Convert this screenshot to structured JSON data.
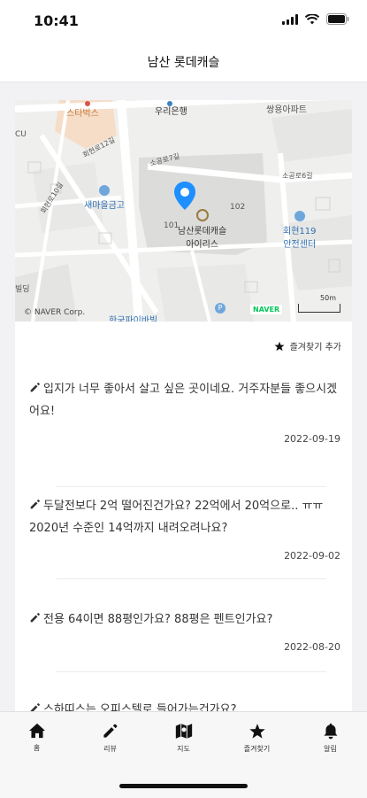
{
  "status_bar": {
    "time": "10:41"
  },
  "nav": {
    "title": "남산 롯데캐슬"
  },
  "map": {
    "labels": {
      "starbucks": "스타벅스",
      "woori": "우리은행",
      "ssangyong": "쌍용아파트",
      "street1": "회현로12길",
      "street2": "소공로7길",
      "street3": "소공로6길",
      "street4": "회현로10길",
      "saemaeul": "새마을금고",
      "bld101": "101",
      "bld102": "102",
      "complex": "남산롯데캐슬",
      "complex2": "아이리스",
      "safety": "회현119",
      "safety2": "안전센터",
      "building": "빌딩",
      "left_edge": "CU",
      "parking": "한국파이바빌",
      "copyright": "© NAVER Corp.",
      "naver": "NAVER",
      "scale": "50m"
    }
  },
  "favorite": {
    "label": "즐겨찾기 추가"
  },
  "reviews": [
    {
      "text": "입지가 너무 좋아서 살고 싶은 곳이네요. 거주자분들 좋으시겠어요!",
      "date": "2022-09-19"
    },
    {
      "text": "두달전보다 2억 떨어진건가요? 22억에서 20억으로.. ㅠㅠ 2020년 수준인 14억까지 내려오려나요?",
      "date": "2022-09-02"
    },
    {
      "text": "전용 64이면 88평인가요? 88평은 펜트인가요?",
      "date": "2022-08-20"
    },
    {
      "text": "스하띠스는 오피스텔로 들어가는건가요?",
      "date": ""
    }
  ],
  "tabs": [
    {
      "label": "홈",
      "icon": "home-icon"
    },
    {
      "label": "리뷰",
      "icon": "pencil-icon"
    },
    {
      "label": "지도",
      "icon": "map-icon"
    },
    {
      "label": "즐겨찾기",
      "icon": "star-icon"
    },
    {
      "label": "알림",
      "icon": "bell-icon"
    }
  ],
  "colors": {
    "accent": "#1e8fff",
    "naver_green": "#03c75a"
  }
}
